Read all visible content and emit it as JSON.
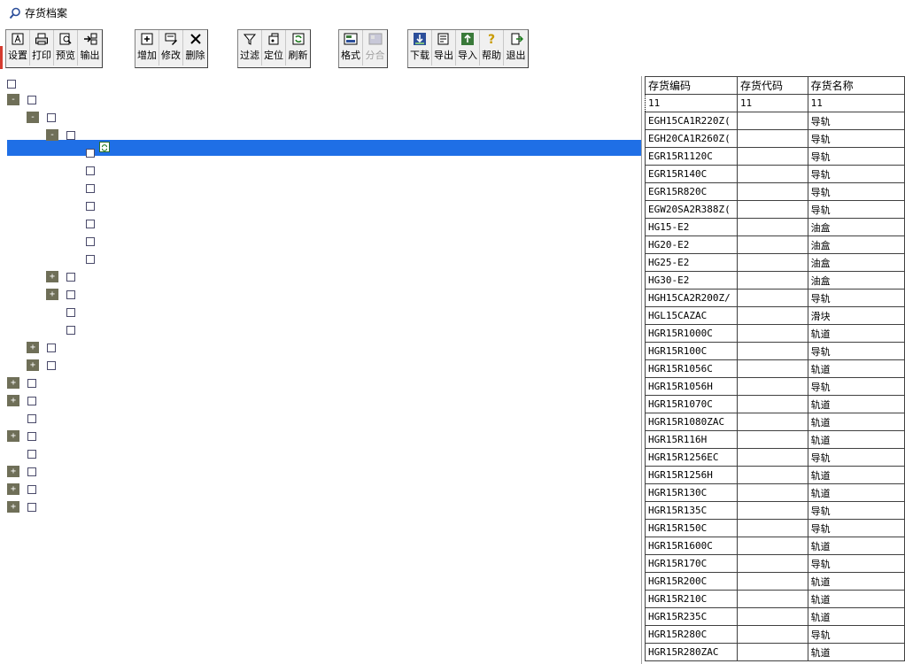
{
  "window": {
    "title": "存货档案"
  },
  "toolbar": {
    "groups": [
      [
        {
          "label": "设置",
          "icon": "settings-icon"
        },
        {
          "label": "打印",
          "icon": "printer-icon"
        },
        {
          "label": "预览",
          "icon": "preview-icon"
        },
        {
          "label": "输出",
          "icon": "export-icon"
        }
      ],
      [
        {
          "label": "增加",
          "icon": "add-icon"
        },
        {
          "label": "修改",
          "icon": "edit-icon"
        },
        {
          "label": "删除",
          "icon": "delete-icon"
        }
      ],
      [
        {
          "label": "过滤",
          "icon": "filter-icon"
        },
        {
          "label": "定位",
          "icon": "locate-icon"
        },
        {
          "label": "刷新",
          "icon": "refresh-icon"
        }
      ],
      [
        {
          "label": "格式",
          "icon": "format-icon"
        },
        {
          "label": "分合",
          "icon": "merge-icon",
          "disabled": true
        }
      ],
      [
        {
          "label": "下载",
          "icon": "download-icon"
        },
        {
          "label": "导出",
          "icon": "export-doc-icon"
        },
        {
          "label": "导入",
          "icon": "import-icon"
        },
        {
          "label": "帮助",
          "icon": "help-icon"
        },
        {
          "label": "退出",
          "icon": "exit-icon"
        }
      ]
    ]
  },
  "grid": {
    "headers": [
      "存货编码",
      "存货代码",
      "存货名称"
    ],
    "rows": [
      [
        "11",
        "11",
        "11"
      ],
      [
        "EGH15CA1R220Z(",
        "",
        "导轨"
      ],
      [
        "EGH20CA1R260Z(",
        "",
        "导轨"
      ],
      [
        "EGR15R1120C",
        "",
        "导轨"
      ],
      [
        "EGR15R140C",
        "",
        "导轨"
      ],
      [
        "EGR15R820C",
        "",
        "导轨"
      ],
      [
        "EGW20SA2R388Z(",
        "",
        "导轨"
      ],
      [
        "HG15-E2",
        "",
        "油盒"
      ],
      [
        "HG20-E2",
        "",
        "油盒"
      ],
      [
        "HG25-E2",
        "",
        "油盒"
      ],
      [
        "HG30-E2",
        "",
        "油盒"
      ],
      [
        "HGH15CA2R200Z/",
        "",
        "导轨"
      ],
      [
        "HGL15CAZAC",
        "",
        "滑块"
      ],
      [
        "HGR15R1000C",
        "",
        "轨道"
      ],
      [
        "HGR15R100C",
        "",
        "导轨"
      ],
      [
        "HGR15R1056C",
        "",
        "轨道"
      ],
      [
        "HGR15R1056H",
        "",
        "导轨"
      ],
      [
        "HGR15R1070C",
        "",
        "轨道"
      ],
      [
        "HGR15R1080ZAC",
        "",
        "轨道"
      ],
      [
        "HGR15R116H",
        "",
        "轨道"
      ],
      [
        "HGR15R1256EC",
        "",
        "导轨"
      ],
      [
        "HGR15R1256H",
        "",
        "轨道"
      ],
      [
        "HGR15R130C",
        "",
        "轨道"
      ],
      [
        "HGR15R135C",
        "",
        "导轨"
      ],
      [
        "HGR15R150C",
        "",
        "导轨"
      ],
      [
        "HGR15R1600C",
        "",
        "轨道"
      ],
      [
        "HGR15R170C",
        "",
        "导轨"
      ],
      [
        "HGR15R200C",
        "",
        "轨道"
      ],
      [
        "HGR15R210C",
        "",
        "轨道"
      ],
      [
        "HGR15R235C",
        "",
        "轨道"
      ],
      [
        "HGR15R280C",
        "",
        "导轨"
      ],
      [
        "HGR15R280ZAC",
        "",
        "轨道"
      ]
    ]
  },
  "tree": {
    "expanders": {
      "collapse": "-",
      "expand": "+"
    }
  }
}
